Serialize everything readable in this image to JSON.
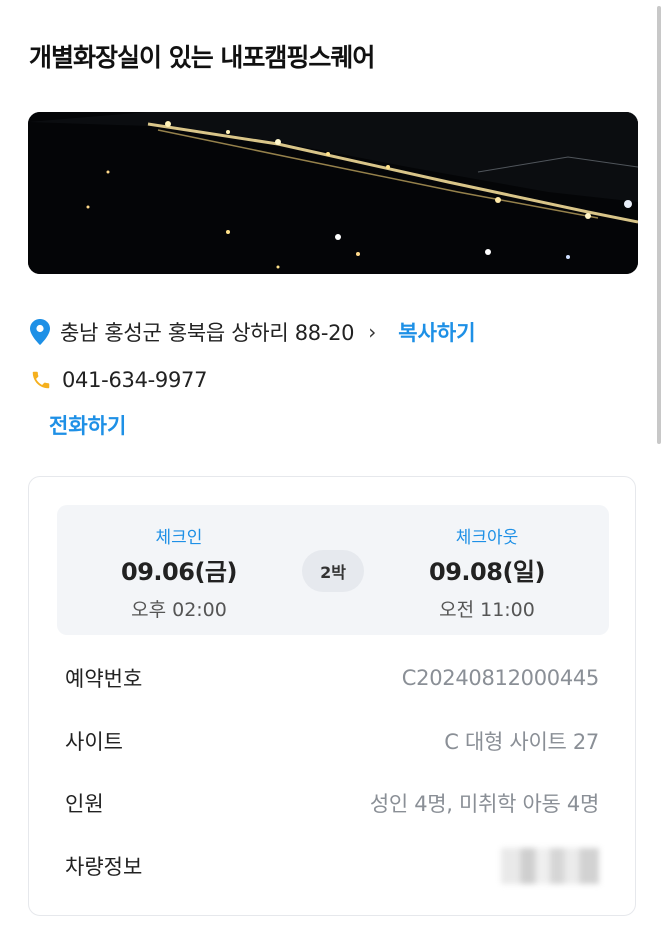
{
  "header": {
    "title": "개별화장실이 있는 내포캠핑스퀘어"
  },
  "hero": {
    "icon": "night-aerial-photo"
  },
  "address": {
    "text": "충남 홍성군 홍북읍 상하리 88-20",
    "chevron": "›",
    "copy_label": "복사하기"
  },
  "phone": {
    "number": "041-634-9977",
    "call_label": "전화하기"
  },
  "stay": {
    "checkin_label": "체크인",
    "checkin_date": "09.06(금)",
    "checkin_time": "오후 02:00",
    "nights": "2박",
    "checkout_label": "체크아웃",
    "checkout_date": "09.08(일)",
    "checkout_time": "오전 11:00"
  },
  "details": [
    {
      "label": "예약번호",
      "value": "C20240812000445"
    },
    {
      "label": "사이트",
      "value": "C 대형 사이트 27"
    },
    {
      "label": "인원",
      "value": "성인 4명, 미취학 아동 4명"
    },
    {
      "label": "차량정보",
      "value": ""
    }
  ],
  "colors": {
    "accent": "#1e90e6",
    "pin": "#1e90e6",
    "phone": "#f5b01e",
    "text": "#222222",
    "muted": "#8a8f96"
  }
}
